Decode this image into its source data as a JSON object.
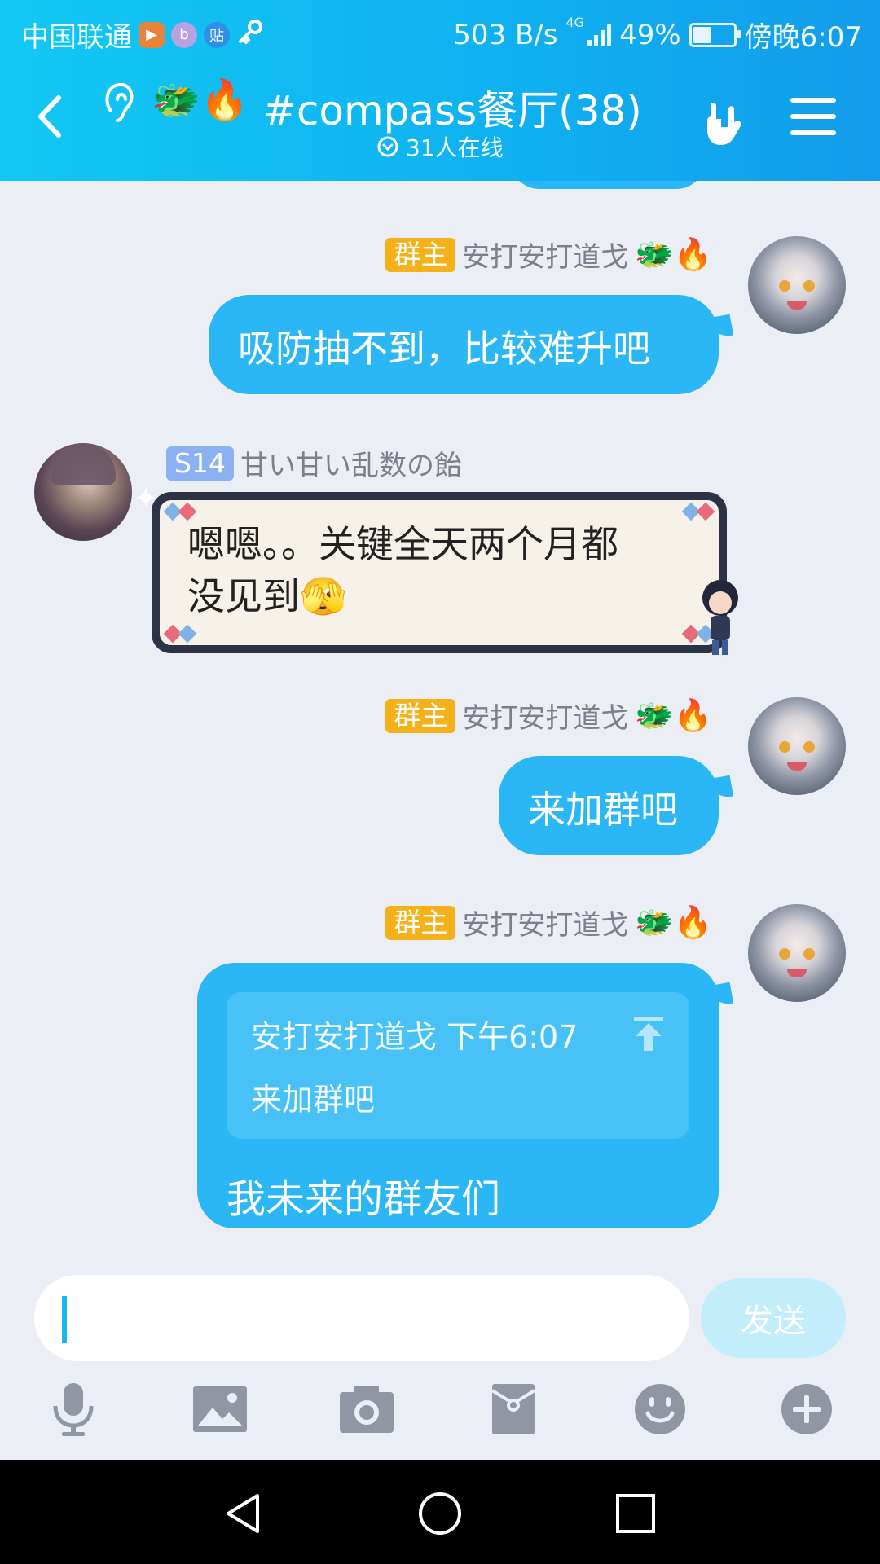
{
  "status_bar": {
    "carrier": "中国联通",
    "net_speed": "503 B/s",
    "network_type": "4G",
    "battery": "49%",
    "battery_level": 0.49,
    "time": "傍晚6:07"
  },
  "header": {
    "title": "#compass餐厅(38)",
    "online": "31人在线",
    "emoji": [
      "🐲",
      "🔥"
    ]
  },
  "messages": [
    {
      "side": "right",
      "badge": "群主",
      "sender": "安打安打道戈",
      "sender_emoji": [
        "🐲",
        "🔥"
      ],
      "text": "吸防抽不到，比较难升吧"
    },
    {
      "side": "left",
      "badge": "S14",
      "sender": "甘い甘い乱数の飴",
      "text_line1": "嗯嗯。。关键全天两个月都",
      "text_line2": "没见到",
      "text_emoji": "🫣"
    },
    {
      "side": "right",
      "badge": "群主",
      "sender": "安打安打道戈",
      "sender_emoji": [
        "🐲",
        "🔥"
      ],
      "text": "来加群吧"
    },
    {
      "side": "right",
      "badge": "群主",
      "sender": "安打安打道戈",
      "sender_emoji": [
        "🐲",
        "🔥"
      ],
      "quote_header": "安打安打道戈 下午6:07",
      "quote_text": "来加群吧",
      "text": "我未来的群友们"
    }
  ],
  "input": {
    "placeholder": "",
    "send_label": "发送"
  },
  "toolbar": [
    "mic-icon",
    "image-icon",
    "camera-icon",
    "red-packet-icon",
    "emoji-icon",
    "plus-icon"
  ],
  "colors": {
    "accent": "#13B3F1",
    "bubble": "#2BB7F5",
    "owner_badge": "#F4B119",
    "level_badge": "#8CB1F2",
    "background": "#EBEEF5"
  }
}
